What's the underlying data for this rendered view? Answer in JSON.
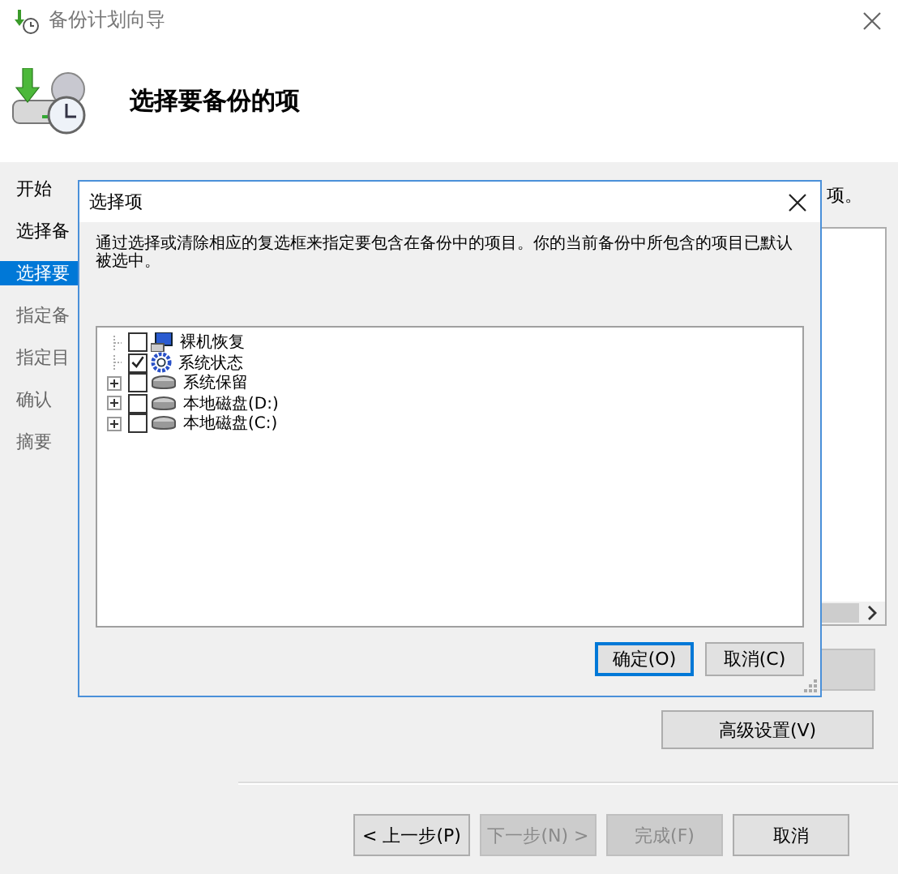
{
  "window": {
    "title": "备份计划向导"
  },
  "header": {
    "heading": "选择要备份的项"
  },
  "sidebar": {
    "items": [
      {
        "label": "开始",
        "selected": false,
        "disabled": false
      },
      {
        "label": "选择备",
        "selected": false,
        "disabled": false
      },
      {
        "label": "选择要",
        "selected": true,
        "disabled": false
      },
      {
        "label": "指定备",
        "selected": false,
        "disabled": true
      },
      {
        "label": "指定目",
        "selected": false,
        "disabled": true
      },
      {
        "label": "确认",
        "selected": false,
        "disabled": true
      },
      {
        "label": "摘要",
        "selected": false,
        "disabled": true
      }
    ]
  },
  "content": {
    "partial_text": "项。",
    "advanced_button": "高级设置(V)"
  },
  "nav_buttons": [
    {
      "label": "< 上一步(P)",
      "disabled": false
    },
    {
      "label": "下一步(N) >",
      "disabled": true
    },
    {
      "label": "完成(F)",
      "disabled": true
    },
    {
      "label": "取消",
      "disabled": false
    }
  ],
  "dialog": {
    "title": "选择项",
    "description": "通过选择或清除相应的复选框来指定要包含在备份中的项目。你的当前备份中所包含的项目已默认被选中。",
    "tree": [
      {
        "label": "裸机恢复",
        "kind": "computer",
        "checked": false,
        "collapsed": false
      },
      {
        "label": "系统状态",
        "kind": "gear",
        "checked": true,
        "collapsed": false
      },
      {
        "label": "系统保留",
        "kind": "disk",
        "checked": false,
        "collapsed": true
      },
      {
        "label": "本地磁盘(D:)",
        "kind": "disk",
        "checked": false,
        "collapsed": true
      },
      {
        "label": "本地磁盘(C:)",
        "kind": "disk",
        "checked": false,
        "collapsed": true
      }
    ],
    "buttons": [
      {
        "label": "确定(O)",
        "default": true
      },
      {
        "label": "取消(C)",
        "default": false
      }
    ]
  }
}
